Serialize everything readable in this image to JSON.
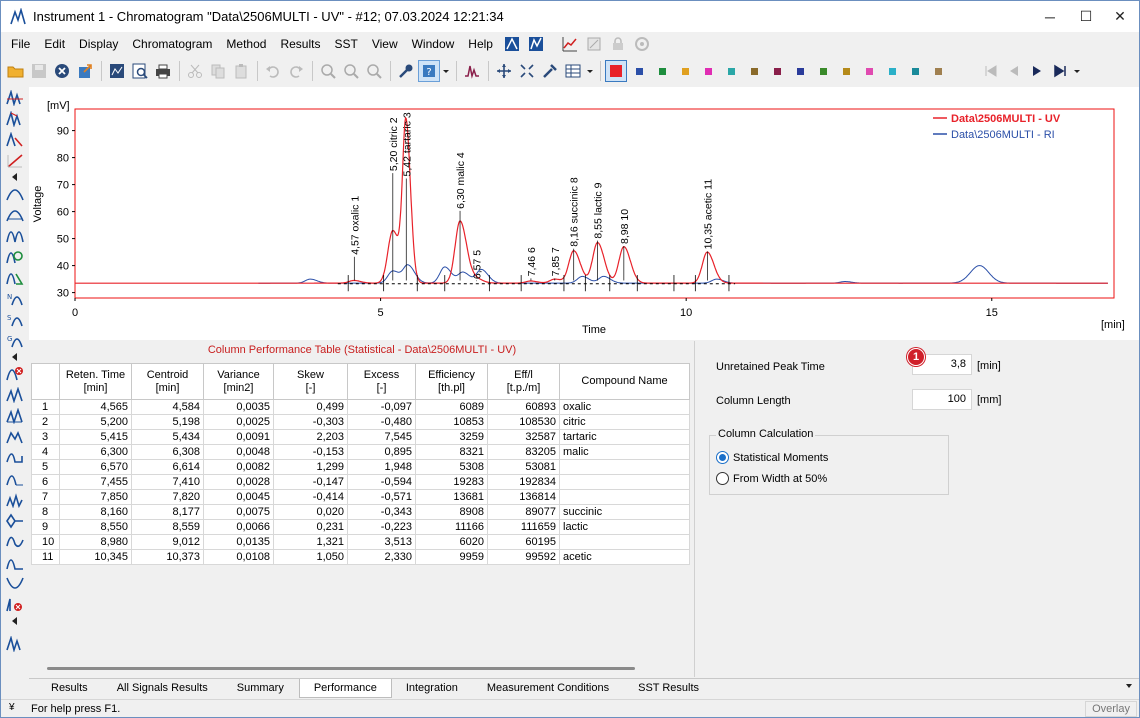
{
  "window": {
    "title": "Instrument 1 - Chromatogram \"Data\\2506MULTI - UV\" - #12;   07.03.2024   12:21:34",
    "minimize": "─",
    "maximize": "☐",
    "close": "✕"
  },
  "menu": [
    "File",
    "Edit",
    "Display",
    "Chromatogram",
    "Method",
    "Results",
    "SST",
    "View",
    "Window",
    "Help"
  ],
  "toolbar": {
    "swatch_colors": [
      "#e8222a",
      "#2b4fa8",
      "#1e8e3e",
      "#e0a020",
      "#e02db3",
      "#2aa7a7",
      "#8a6a2a",
      "#8a1f4a",
      "#2a3b9a",
      "#3a8a2a",
      "#b58a1a",
      "#e04ab0",
      "#2bb0c8",
      "#1a8a9a",
      "#a08050"
    ]
  },
  "chart": {
    "y_unit": "[mV]",
    "y_label": "Voltage",
    "x_label": "Time",
    "x_unit": "[min]",
    "legend": [
      "Data\\2506MULTI - UV",
      "Data\\2506MULTI - RI"
    ]
  },
  "chart_data": {
    "type": "line",
    "xlabel": "Time",
    "ylabel": "Voltage",
    "xlim": [
      0,
      17
    ],
    "ylim": [
      28,
      98
    ],
    "x_ticks": [
      0,
      5,
      10,
      15
    ],
    "y_ticks": [
      30,
      40,
      50,
      60,
      70,
      80,
      90
    ],
    "grid": false,
    "legend_position": "top-right",
    "baseline_uv": 33.5,
    "baseline_ri": 33.5,
    "series": [
      {
        "name": "Data\\2506MULTI - UV",
        "color": "#e8222a",
        "peaks": [
          {
            "t": 4.565,
            "h": 1.0
          },
          {
            "t": 5.2,
            "h": 19.5
          },
          {
            "t": 5.415,
            "h": 58.5
          },
          {
            "t": 6.3,
            "h": 23.0
          },
          {
            "t": 6.57,
            "h": 1.5
          },
          {
            "t": 7.455,
            "h": 0.8
          },
          {
            "t": 7.85,
            "h": 1.5
          },
          {
            "t": 8.16,
            "h": 12.0
          },
          {
            "t": 8.55,
            "h": 15.0
          },
          {
            "t": 8.98,
            "h": 13.5
          },
          {
            "t": 10.345,
            "h": 11.5
          }
        ]
      },
      {
        "name": "Data\\2506MULTI - RI",
        "color": "#2b4fa8",
        "peaks": [
          {
            "t": 3.85,
            "h": 1.5
          },
          {
            "t": 5.2,
            "h": 4.5
          },
          {
            "t": 5.45,
            "h": 6.5
          },
          {
            "t": 6.05,
            "h": 6.0
          },
          {
            "t": 6.35,
            "h": 4.0
          },
          {
            "t": 6.65,
            "h": 5.0
          },
          {
            "t": 8.3,
            "h": 2.5
          },
          {
            "t": 8.65,
            "h": 2.5
          },
          {
            "t": 10.5,
            "h": 1.5
          },
          {
            "t": 12.6,
            "h": 0.6
          },
          {
            "t": 14.8,
            "h": 6.5
          }
        ]
      }
    ],
    "peak_labels": [
      {
        "t": 4.57,
        "text": "4,57 oxalic",
        "num": "1",
        "top": 44
      },
      {
        "t": 5.2,
        "text": "5,20 citric",
        "num": "2",
        "top": 75
      },
      {
        "t": 5.42,
        "text": "5,42 tartaric",
        "num": "3",
        "top": 73
      },
      {
        "t": 6.3,
        "text": "6,30 malic",
        "num": "4",
        "top": 61
      },
      {
        "t": 6.57,
        "text": "6,57",
        "num": "5",
        "top": 35
      },
      {
        "t": 7.46,
        "text": "7,46",
        "num": "6",
        "top": 36
      },
      {
        "t": 7.85,
        "text": "7,85",
        "num": "7",
        "top": 36
      },
      {
        "t": 8.16,
        "text": "8,16 succinic",
        "num": "8",
        "top": 47
      },
      {
        "t": 8.55,
        "text": "8,55 lactic",
        "num": "9",
        "top": 50
      },
      {
        "t": 8.98,
        "text": "8,98",
        "num": "10",
        "top": 48
      },
      {
        "t": 10.35,
        "text": "10,35 acetic",
        "num": "11",
        "top": 46
      }
    ]
  },
  "table": {
    "title": "Column Performance Table (Statistical - Data\\2506MULTI - UV)",
    "headers": [
      [
        "",
        ""
      ],
      [
        "Reten. Time",
        "[min]"
      ],
      [
        "Centroid",
        "[min]"
      ],
      [
        "Variance",
        "[min2]"
      ],
      [
        "Skew",
        "[-]"
      ],
      [
        "Excess",
        "[-]"
      ],
      [
        "Efficiency",
        "[th.pl]"
      ],
      [
        "Eff/l",
        "[t.p./m]"
      ],
      [
        "Compound Name",
        ""
      ]
    ],
    "rows": [
      [
        "1",
        "4,565",
        "4,584",
        "0,0035",
        "0,499",
        "-0,097",
        "6089",
        "60893",
        "oxalic"
      ],
      [
        "2",
        "5,200",
        "5,198",
        "0,0025",
        "-0,303",
        "-0,480",
        "10853",
        "108530",
        "citric"
      ],
      [
        "3",
        "5,415",
        "5,434",
        "0,0091",
        "2,203",
        "7,545",
        "3259",
        "32587",
        "tartaric"
      ],
      [
        "4",
        "6,300",
        "6,308",
        "0,0048",
        "-0,153",
        "0,895",
        "8321",
        "83205",
        "malic"
      ],
      [
        "5",
        "6,570",
        "6,614",
        "0,0082",
        "1,299",
        "1,948",
        "5308",
        "53081",
        ""
      ],
      [
        "6",
        "7,455",
        "7,410",
        "0,0028",
        "-0,147",
        "-0,594",
        "19283",
        "192834",
        ""
      ],
      [
        "7",
        "7,850",
        "7,820",
        "0,0045",
        "-0,414",
        "-0,571",
        "13681",
        "136814",
        ""
      ],
      [
        "8",
        "8,160",
        "8,177",
        "0,0075",
        "0,020",
        "-0,343",
        "8908",
        "89077",
        "succinic"
      ],
      [
        "9",
        "8,550",
        "8,559",
        "0,0066",
        "0,231",
        "-0,223",
        "11166",
        "111659",
        "lactic"
      ],
      [
        "10",
        "8,980",
        "9,012",
        "0,0135",
        "1,321",
        "3,513",
        "6020",
        "60195",
        ""
      ],
      [
        "11",
        "10,345",
        "10,373",
        "0,0108",
        "1,050",
        "2,330",
        "9959",
        "99592",
        "acetic"
      ]
    ]
  },
  "settings": {
    "unretained_label": "Unretained Peak Time",
    "unretained_value": "3,8",
    "unretained_unit": "[min]",
    "column_length_label": "Column Length",
    "column_length_value": "100",
    "column_length_unit": "[mm]",
    "column_calc_label": "Column Calculation",
    "option_statistical": "Statistical Moments",
    "option_width": "From Width at 50%",
    "badge": "1"
  },
  "tabs": [
    "Results",
    "All Signals Results",
    "Summary",
    "Performance",
    "Integration",
    "Measurement Conditions",
    "SST Results"
  ],
  "active_tab": "Performance",
  "status": {
    "help": "For help press F1.",
    "mode": "Overlay"
  }
}
